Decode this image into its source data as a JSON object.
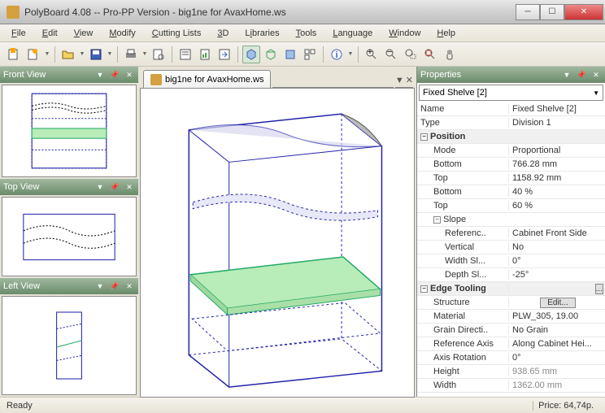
{
  "title": "PolyBoard 4.08 -- Pro-PP Version - big1ne for AvaxHome.ws",
  "menu": [
    "File",
    "Edit",
    "View",
    "Modify",
    "Cutting Lists",
    "3D",
    "Libraries",
    "Tools",
    "Language",
    "Window",
    "Help"
  ],
  "tab": {
    "label": "big1ne for AvaxHome.ws"
  },
  "panels": {
    "front": "Front View",
    "top": "Top View",
    "left": "Left View",
    "props": "Properties"
  },
  "propdrop": "Fixed Shelve [2]",
  "props": {
    "name_l": "Name",
    "name_v": "Fixed Shelve [2]",
    "type_l": "Type",
    "type_v": "Division 1",
    "position": "Position",
    "mode_l": "Mode",
    "mode_v": "Proportional",
    "bottom_mm_l": "Bottom",
    "bottom_mm_v": "766.28 mm",
    "top_mm_l": "Top",
    "top_mm_v": "1158.92 mm",
    "bottom_pct_l": "Bottom",
    "bottom_pct_v": "40 %",
    "top_pct_l": "Top",
    "top_pct_v": "60 %",
    "slope": "Slope",
    "ref_l": "Referenc..",
    "ref_v": "Cabinet Front Side",
    "vert_l": "Vertical",
    "vert_v": "No",
    "wslope_l": "Width Sl...",
    "wslope_v": "0°",
    "dslope_l": "Depth Sl...",
    "dslope_v": "-25°",
    "edgetool": "Edge Tooling",
    "struct_l": "Structure",
    "struct_v": "Edit...",
    "mat_l": "Material",
    "mat_v": "PLW_305, 19.00",
    "grain_l": "Grain Directi..",
    "grain_v": "No Grain",
    "refaxis_l": "Reference Axis",
    "refaxis_v": "Along Cabinet Hei...",
    "axisrot_l": "Axis Rotation",
    "axisrot_v": "0°",
    "height_l": "Height",
    "height_v": "938.65 mm",
    "width_l": "Width",
    "width_v": "1362.00 mm"
  },
  "status": {
    "ready": "Ready",
    "price": "Price: 64,74p."
  }
}
